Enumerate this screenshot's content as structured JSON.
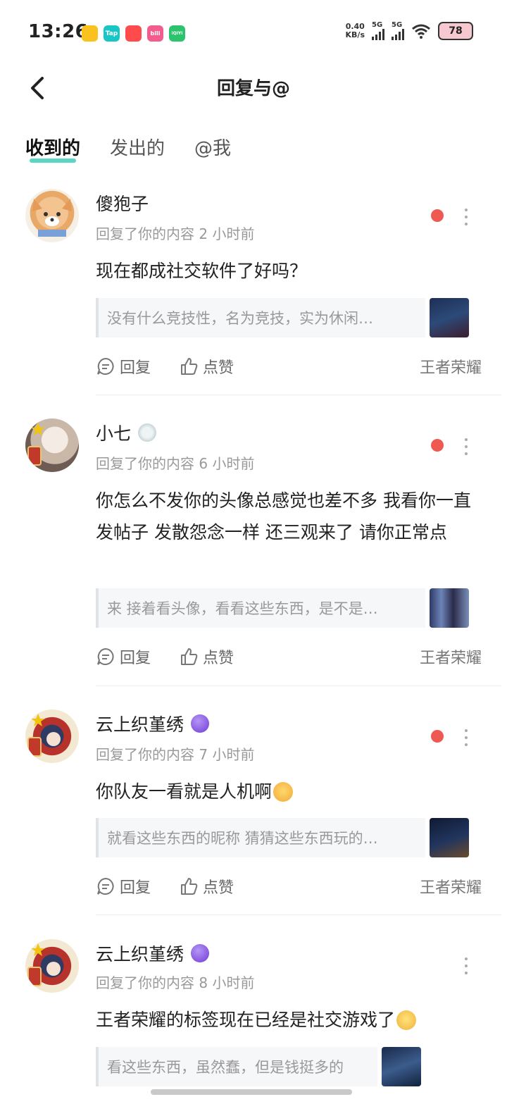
{
  "status_bar": {
    "time": "13:26",
    "apps": [
      {
        "name": "app-icon-1",
        "label": "",
        "color": "#f9c21e"
      },
      {
        "name": "taptap-icon",
        "label": "Tap",
        "color": "#19c6c6"
      },
      {
        "name": "app-icon-3",
        "label": "",
        "color": "#ff4b4b"
      },
      {
        "name": "bilibili-icon",
        "label": "bili",
        "color": "#f25d8e"
      },
      {
        "name": "iqiyi-icon",
        "label": "iQIYI",
        "color": "#2bc36b"
      }
    ],
    "speed_value": "0.40",
    "speed_unit": "KB/s",
    "net1": "5G",
    "net2": "5G",
    "battery": "78"
  },
  "header": {
    "title": "回复与@"
  },
  "tabs": [
    {
      "label": "收到的",
      "active": true
    },
    {
      "label": "发出的",
      "active": false
    },
    {
      "label": "@我",
      "active": false
    }
  ],
  "actions": {
    "reply": "回复",
    "like": "点赞"
  },
  "items": [
    {
      "name": "傻狍子",
      "meta": "回复了你的内容 2 小时前",
      "content": "现在都成社交软件了好吗？",
      "quote": "没有什么竞技性，名为竞技，实为休闲…",
      "tag": "王者荣耀",
      "unread": true
    },
    {
      "name": "小七",
      "meta": "回复了你的内容 6 小时前",
      "content": "你怎么不发你的头像总感觉也差不多  我看你一直发帖子 发散怨念一样  还三观来了  请你正常点",
      "quote": "来 接着看头像，看看这些东西，是不是…",
      "tag": "王者荣耀",
      "unread": true
    },
    {
      "name": "云上织堇绣",
      "meta": "回复了你的内容 7 小时前",
      "content": "你队友一看就是人机啊",
      "quote": "就看这些东西的昵称 猜猜这些东西玩的…",
      "tag": "王者荣耀",
      "unread": true
    },
    {
      "name": "云上织堇绣",
      "meta": "回复了你的内容 8 小时前",
      "content": "王者荣耀的标签现在已经是社交游戏了",
      "quote": "看这些东西，虽然蠢，但是钱挺多的",
      "tag": "",
      "unread": false
    }
  ]
}
